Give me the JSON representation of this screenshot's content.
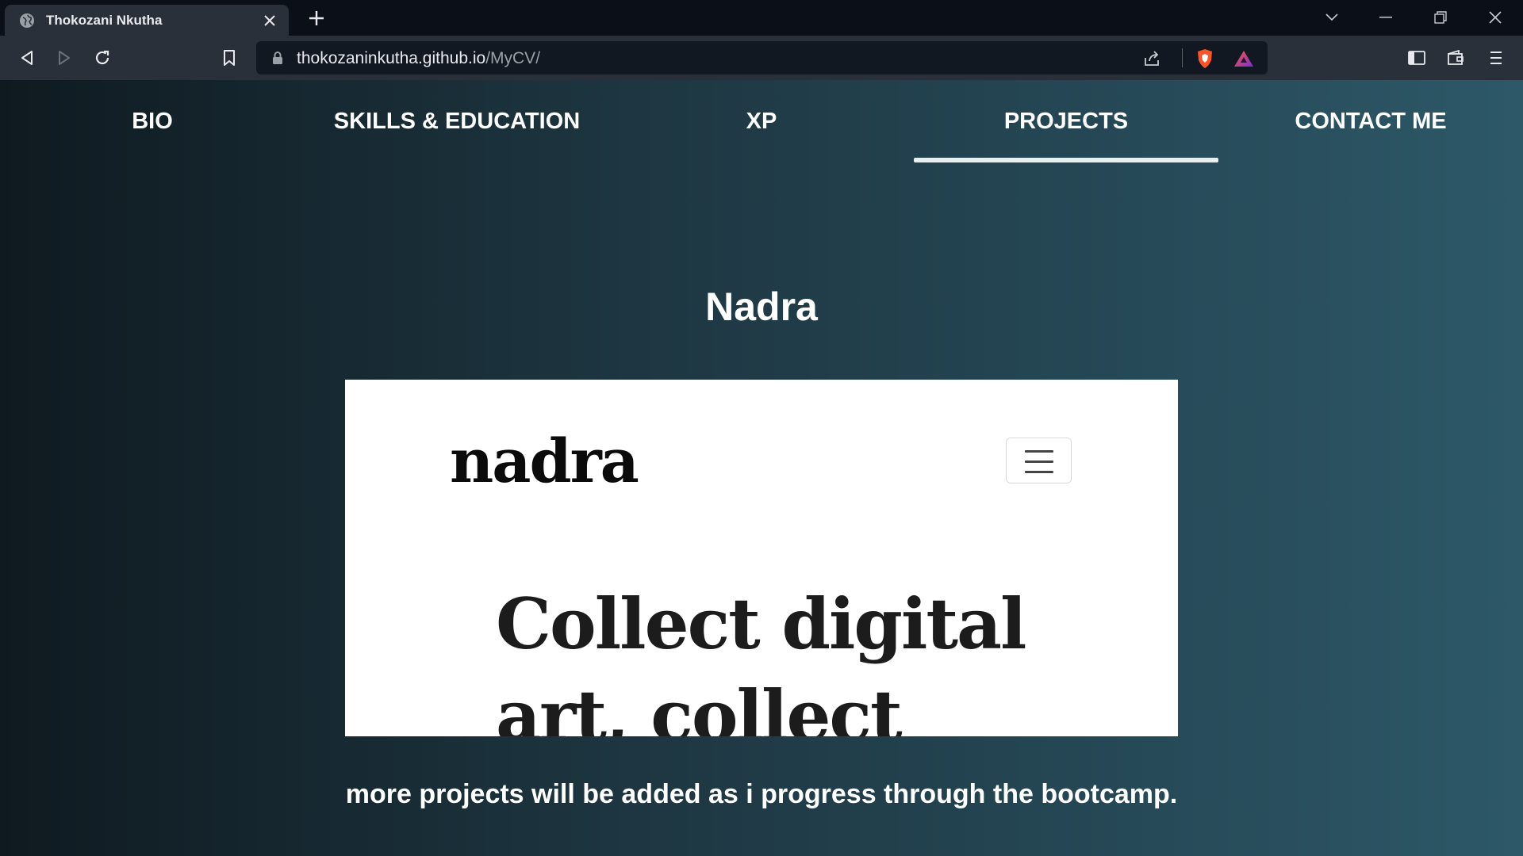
{
  "browser": {
    "tab_title": "Thokozani Nkutha",
    "url_host": "thokozaninkutha.github.io",
    "url_path": "/MyCV/",
    "colors": {
      "frame": "#0b0f17",
      "toolbar": "#2a3039",
      "urlbar": "#121821"
    }
  },
  "nav": {
    "items": [
      {
        "label": "BIO"
      },
      {
        "label": "SKILLS & EDUCATION"
      },
      {
        "label": "XP"
      },
      {
        "label": "PROJECTS",
        "active": true
      },
      {
        "label": "CONTACT ME"
      }
    ]
  },
  "project": {
    "title": "Nadra",
    "preview": {
      "logo": "nadra",
      "hero_line1": "Collect digital",
      "hero_line2": "art, collect"
    }
  },
  "footer": {
    "note": "more projects will be added as i progress through the bootcamp."
  }
}
